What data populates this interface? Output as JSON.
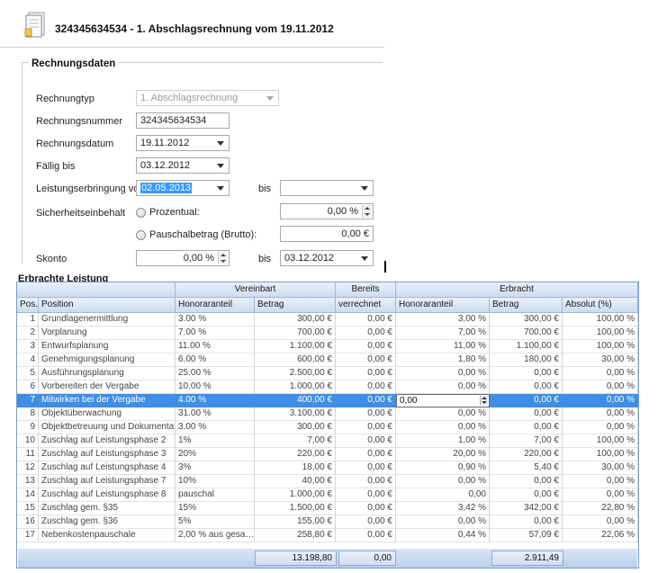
{
  "header": {
    "title": "324345634534 - 1. Abschlagsrechnung vom 19.11.2012",
    "icon": "document-icon"
  },
  "rechnungsdaten": {
    "group_title": "Rechnungsdaten",
    "rechnungtyp": {
      "label": "Rechnungtyp",
      "value": "1. Abschlagsrechnung"
    },
    "rechnungsnummer": {
      "label": "Rechnungsnummer",
      "value": "324345634534"
    },
    "rechnungsdatum": {
      "label": "Rechnungsdatum",
      "value": "19.11.2012"
    },
    "faellig_bis": {
      "label": "Fällig bis",
      "value": "03.12.2012"
    },
    "leistungserbringung": {
      "label": "Leistungserbringung von",
      "from": "02.05.2013",
      "bis_label": "bis",
      "to": ""
    },
    "sicherheitseinbehalt": {
      "label": "Sicherheitseinbehalt",
      "prozentual_label": "Prozentual:",
      "prozentual_value": "0,00 %",
      "pauschal_label": "Pauschalbetrag (Brutto):",
      "pauschal_value": "0,00 €"
    },
    "skonto": {
      "label": "Skonto",
      "value": "0,00 %",
      "bis_label": "bis",
      "to": "03.12.2012"
    }
  },
  "grid": {
    "title": "Erbrachte Leistung",
    "group_headers": {
      "vereinbart": "Vereinbart",
      "bereits": "Bereits",
      "erbracht": "Erbracht"
    },
    "columns": [
      "Pos.",
      "Position",
      "Honoraranteil",
      "Betrag",
      "verrechnet",
      "Honoraranteil",
      "Betrag",
      "Absolut (%)"
    ],
    "rows": [
      [
        "1",
        "Grundlagenermittlung",
        "3.00 %",
        "300,00 €",
        "0,00 €",
        "3,00 %",
        "300,00 €",
        "100,00 %"
      ],
      [
        "2",
        "Vorplanung",
        "7.00 %",
        "700,00 €",
        "0,00 €",
        "7,00 %",
        "700,00 €",
        "100,00 %"
      ],
      [
        "3",
        "Entwurfsplanung",
        "11.00 %",
        "1.100,00 €",
        "0,00 €",
        "11,00 %",
        "1.100,00 €",
        "100,00 %"
      ],
      [
        "4",
        "Genehmigungsplanung",
        "6.00 %",
        "600,00 €",
        "0,00 €",
        "1,80 %",
        "180,00 €",
        "30,00 %"
      ],
      [
        "5",
        "Ausführungsplanung",
        "25.00 %",
        "2.500,00 €",
        "0,00 €",
        "0,00 %",
        "0,00 €",
        "0,00 %"
      ],
      [
        "6",
        "Vorbereiten der Vergabe",
        "10.00 %",
        "1.000,00 €",
        "0,00 €",
        "0,00 %",
        "0,00 €",
        "0,00 %"
      ],
      [
        "7",
        "Mitwirken bei der Vergabe",
        "4.00 %",
        "400,00 €",
        "0,00 €",
        "0,00",
        "0,00 €",
        "0,00 %"
      ],
      [
        "8",
        "Objektüberwachung",
        "31.00 %",
        "3.100,00 €",
        "0,00 €",
        "0,00 %",
        "0,00 €",
        "0,00 %"
      ],
      [
        "9",
        "Objektbetreuung und Dokumentation",
        "3.00 %",
        "300,00 €",
        "0,00 €",
        "0,00 %",
        "0,00 €",
        "0,00 %"
      ],
      [
        "10",
        "Zuschlag auf Leistungsphase 2",
        "1%",
        "7,00 €",
        "0,00 €",
        "1,00 %",
        "7,00 €",
        "100,00 %"
      ],
      [
        "11",
        "Zuschlag auf Leistungsphase 3",
        "20%",
        "220,00 €",
        "0,00 €",
        "20,00 %",
        "220,00 €",
        "100,00 %"
      ],
      [
        "12",
        "Zuschlag auf Leistungsphase 4",
        "3%",
        "18,00 €",
        "0,00 €",
        "0,90 %",
        "5,40 €",
        "30,00 %"
      ],
      [
        "13",
        "Zuschlag auf Leistungsphase 7",
        "10%",
        "40,00 €",
        "0,00 €",
        "0,00 %",
        "0,00 €",
        "0,00 %"
      ],
      [
        "14",
        "Zuschlag auf Leistungsphase 8",
        "pauschal",
        "1.000,00 €",
        "0,00 €",
        "0,00",
        "0,00 €",
        "0,00 %"
      ],
      [
        "15",
        "Zuschlag gem. §35",
        "15%",
        "1.500,00 €",
        "0,00 €",
        "3,42 %",
        "342,00 €",
        "22,80 %"
      ],
      [
        "16",
        "Zuschlag gem. §36",
        "5%",
        "155,00 €",
        "0,00 €",
        "0,00 %",
        "0,00 €",
        "0,00 %"
      ],
      [
        "17",
        "Nebenkostenpauschale",
        "2,00 % aus gesa…",
        "258,80 €",
        "0,00 €",
        "0,44 %",
        "57,09 €",
        "22,06 %"
      ]
    ],
    "selected_row": 7,
    "totals": {
      "vereinbart_betrag": "13.198,80",
      "bereits_verrechnet": "0,00",
      "erbracht_betrag": "2.911,49"
    },
    "colors": {
      "header": "#cddcf0",
      "selection": "#3d8ee6",
      "border": "#7a9cc6"
    }
  }
}
